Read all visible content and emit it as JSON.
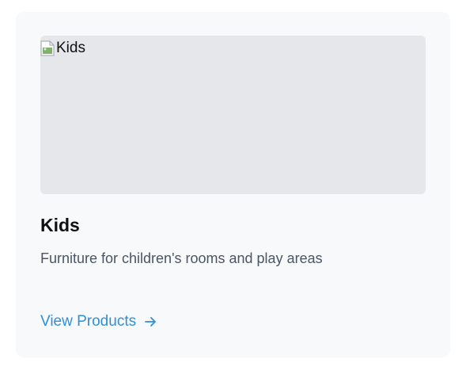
{
  "card": {
    "image_alt": "Kids",
    "title": "Kids",
    "description": "Furniture for children's rooms and play areas",
    "cta_label": "View Products",
    "cta_icon": "arrow-right-icon",
    "image_icon": "broken-image-icon"
  },
  "colors": {
    "card_background": "#f8f9fb",
    "image_placeholder": "#e5e7eb",
    "title": "#111111",
    "description": "#4b5563",
    "link": "#2f8fd8"
  }
}
